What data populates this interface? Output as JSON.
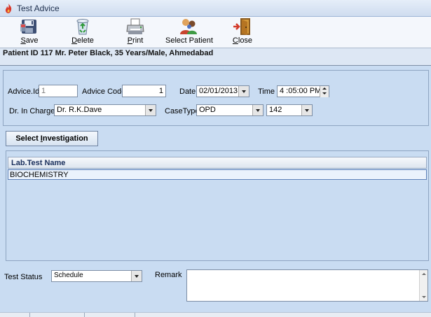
{
  "window": {
    "title": "Test Advice",
    "icon": "flame-app-icon"
  },
  "toolbar": {
    "save": {
      "hotkey": "S",
      "rest": "ave",
      "icon": "save-disk-icon"
    },
    "delete": {
      "hotkey": "D",
      "rest": "elete",
      "icon": "recycle-bin-icon"
    },
    "print": {
      "hotkey": "P",
      "rest": "rint",
      "icon": "printer-icon"
    },
    "select_patient": {
      "label": "Select Patient",
      "icon": "patients-icon"
    },
    "close": {
      "hotkey": "C",
      "rest": "lose",
      "icon": "exit-door-icon"
    }
  },
  "patient_info": "Patient ID 117 Mr. Peter Black, 35 Years/Male, Ahmedabad",
  "form": {
    "advice_id_label": "Advice.Id",
    "advice_id_value": "1",
    "advice_code_label": "Advice Code",
    "advice_code_value": "1",
    "date_label": "Date",
    "date_value": "02/01/2013",
    "time_label": "Time",
    "time_value": "4 :05:00 PM",
    "dr_in_charge_label": "Dr. In Charge",
    "dr_in_charge_value": "Dr. R.K.Dave",
    "case_type_label": "CaseType",
    "case_type_value": "OPD",
    "case_number_value": "142"
  },
  "select_investigation": {
    "hotkey_prefix": "Select ",
    "hotkey": "I",
    "rest": "nvestigation"
  },
  "grid": {
    "column": "Lab.Test Name",
    "rows": [
      "BIOCHEMISTRY"
    ]
  },
  "test_status": {
    "label": "Test Status",
    "value": "Schedule"
  },
  "remark": {
    "label": "Remark",
    "value": ""
  }
}
